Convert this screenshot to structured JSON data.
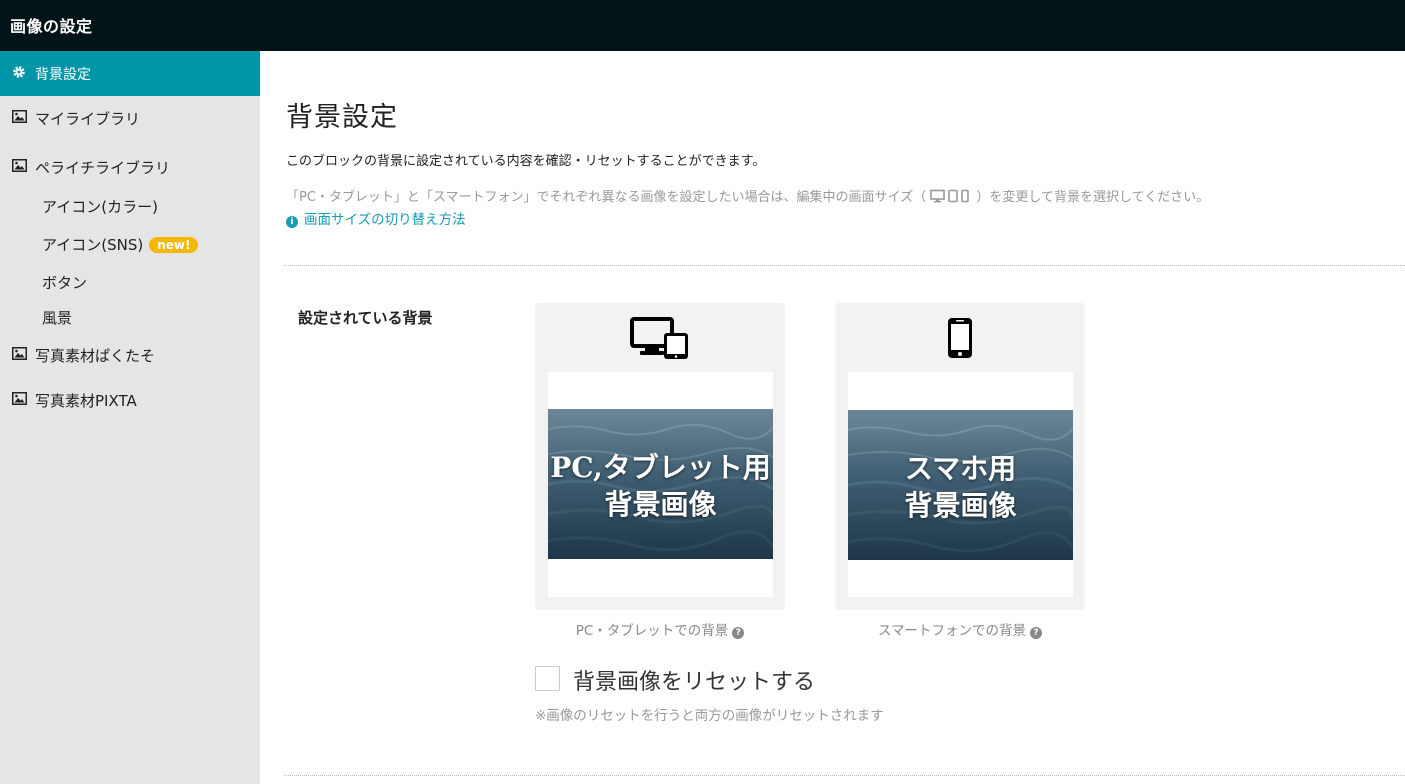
{
  "header": {
    "title": "画像の設定"
  },
  "sidebar": {
    "active": {
      "label": "背景設定",
      "icon": "gear-icon"
    },
    "items": [
      {
        "label": "マイライブラリ",
        "icon": "image-icon"
      },
      {
        "label": "ペライチライブラリ",
        "icon": "image-icon"
      },
      {
        "label": "写真素材ぱくたそ",
        "icon": "image-icon"
      },
      {
        "label": "写真素材PIXTA",
        "icon": "image-icon"
      }
    ],
    "subitems": [
      {
        "label": "アイコン(カラー)"
      },
      {
        "label": "アイコン(SNS)",
        "badge": "new!"
      },
      {
        "label": "ボタン"
      },
      {
        "label": "風景"
      }
    ]
  },
  "main": {
    "title": "背景設定",
    "description": "このブロックの背景に設定されている内容を確認・リセットすることができます。",
    "note_before": "「PC・タブレット」と「スマートフォン」でそれぞれ異なる画像を設定したい場合は、編集中の画面サイズ（",
    "note_after": "）を変更して背景を選択してください。",
    "help_link": "画面サイズの切り替え方法",
    "section_label": "設定されている背景",
    "cards": [
      {
        "image_text_1": "PC,タブレット用",
        "image_text_2": "背景画像",
        "caption": "PC・タブレットでの背景",
        "icon": "desktop-tablet-icon"
      },
      {
        "image_text_1": "スマホ用",
        "image_text_2": "背景画像",
        "caption": "スマートフォンでの背景",
        "icon": "smartphone-icon"
      }
    ],
    "reset_label": "背景画像をリセットする",
    "reset_note": "※画像のリセットを行うと両方の画像がリセットされます",
    "reset_checked": false
  },
  "colors": {
    "accent": "#0096a8",
    "header_bg": "#031418",
    "badge": "#f5b800",
    "link": "#1a9ab5"
  }
}
